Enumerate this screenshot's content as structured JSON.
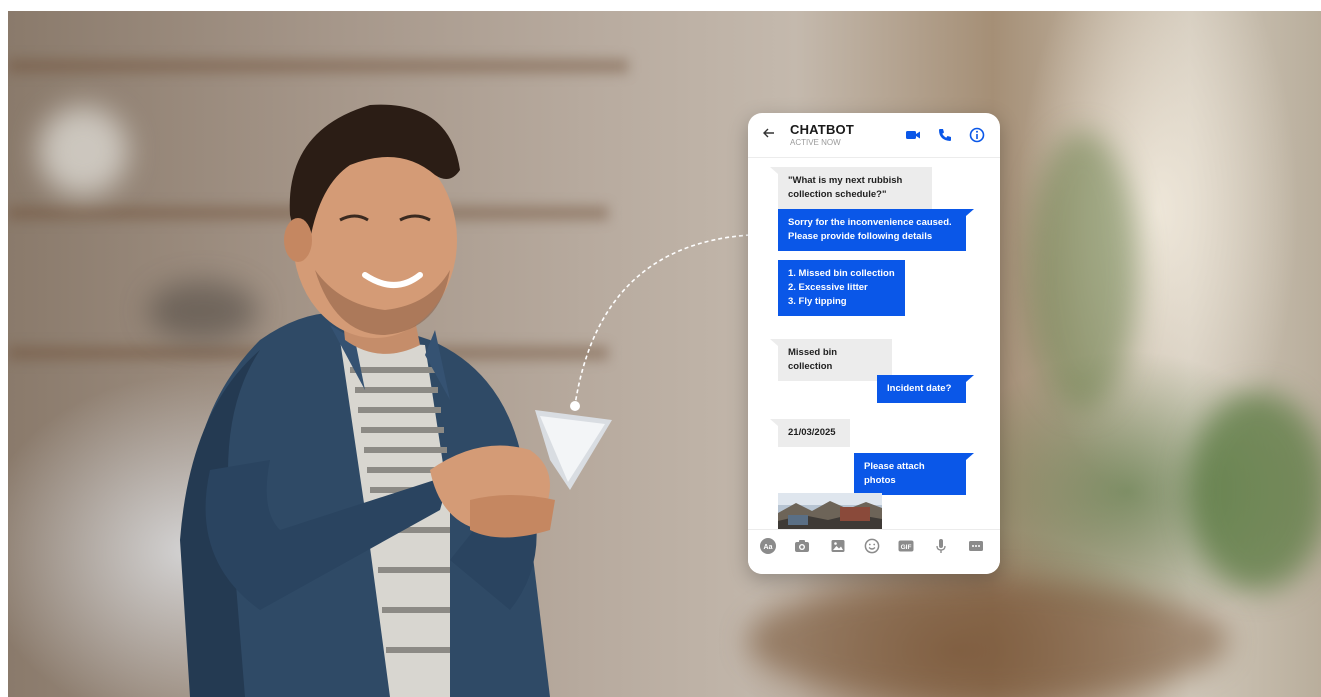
{
  "chat": {
    "title": "CHATBOT",
    "status": "ACTIVE NOW",
    "messages": [
      {
        "from": "user",
        "text": "\"What is my next rubbish collection schedule?\""
      },
      {
        "from": "bot",
        "text": "Sorry for the inconvenience caused. Please provide following details"
      },
      {
        "from": "bot",
        "lines": [
          "1. Missed bin collection",
          "2. Excessive litter",
          "3. Fly tipping"
        ]
      },
      {
        "from": "user",
        "text": "Missed bin collection"
      },
      {
        "from": "bot",
        "text": "Incident date?"
      },
      {
        "from": "user",
        "text": "21/03/2025"
      },
      {
        "from": "bot",
        "text": "Please attach photos"
      }
    ]
  },
  "toolbar": {
    "text_icon_label": "Aa",
    "gif_label": "GIF",
    "icons": [
      "text-format-icon",
      "camera-icon",
      "image-icon",
      "emoji-icon",
      "gif-icon",
      "microphone-icon",
      "more-icon"
    ]
  },
  "header_icons": [
    "back-arrow-icon",
    "video-call-icon",
    "phone-call-icon",
    "info-icon"
  ],
  "colors": {
    "accent": "#0a57e8",
    "incoming_bubble": "#ececec"
  }
}
